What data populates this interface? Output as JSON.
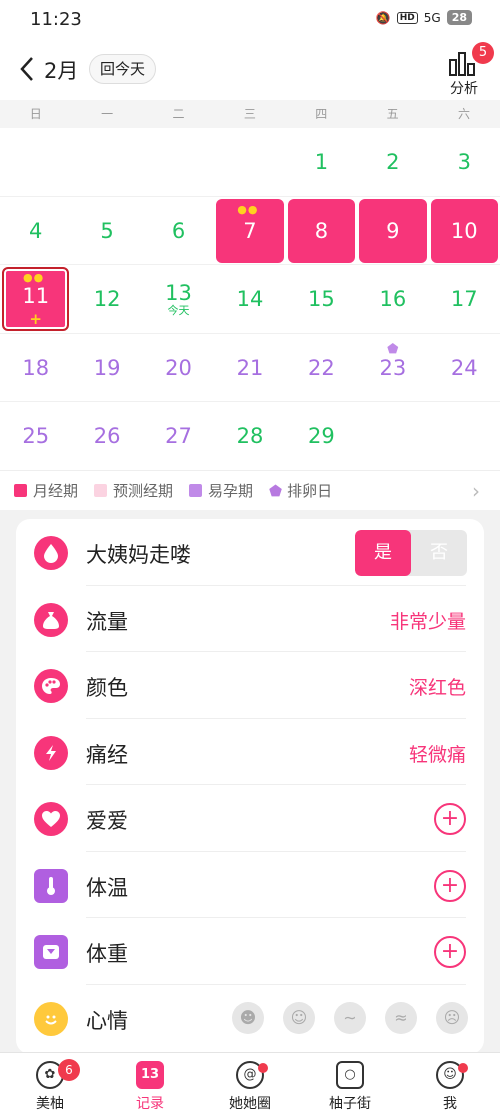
{
  "status": {
    "time": "11:23",
    "hd": "HD",
    "network": "5G",
    "battery": "28"
  },
  "header": {
    "back_icon": "chevron-left-icon",
    "month": "2月",
    "today_button": "回今天",
    "analysis_label": "分析",
    "analysis_badge": "5"
  },
  "weekdays": [
    "日",
    "一",
    "二",
    "三",
    "四",
    "五",
    "六"
  ],
  "calendar": {
    "rows": [
      [
        null,
        null,
        null,
        null,
        {
          "n": "1",
          "t": "normal"
        },
        {
          "n": "2",
          "t": "normal"
        },
        {
          "n": "3",
          "t": "normal"
        }
      ],
      [
        {
          "n": "4",
          "t": "normal"
        },
        {
          "n": "5",
          "t": "normal"
        },
        {
          "n": "6",
          "t": "normal"
        },
        {
          "n": "7",
          "t": "period",
          "mark_top": true
        },
        {
          "n": "8",
          "t": "period"
        },
        {
          "n": "9",
          "t": "period"
        },
        {
          "n": "10",
          "t": "period"
        }
      ],
      [
        {
          "n": "11",
          "t": "period",
          "selected": true,
          "mark_top": true,
          "mark_bottom": true
        },
        {
          "n": "12",
          "t": "normal"
        },
        {
          "n": "13",
          "t": "normal",
          "sub": "今天"
        },
        {
          "n": "14",
          "t": "normal"
        },
        {
          "n": "15",
          "t": "normal"
        },
        {
          "n": "16",
          "t": "normal"
        },
        {
          "n": "17",
          "t": "normal"
        }
      ],
      [
        {
          "n": "18",
          "t": "fertile"
        },
        {
          "n": "19",
          "t": "fertile"
        },
        {
          "n": "20",
          "t": "fertile"
        },
        {
          "n": "21",
          "t": "fertile"
        },
        {
          "n": "22",
          "t": "fertile"
        },
        {
          "n": "23",
          "t": "fertile",
          "flower": true
        },
        {
          "n": "24",
          "t": "fertile"
        }
      ],
      [
        {
          "n": "25",
          "t": "fertile"
        },
        {
          "n": "26",
          "t": "fertile"
        },
        {
          "n": "27",
          "t": "fertile"
        },
        {
          "n": "28",
          "t": "normal"
        },
        {
          "n": "29",
          "t": "normal"
        },
        null,
        null
      ]
    ]
  },
  "legend": {
    "period": "月经期",
    "predicted": "预测经期",
    "fertile": "易孕期",
    "ovulation": "排卵日",
    "colors": {
      "period": "#f7357a",
      "predicted": "#fbd3e1",
      "fertile": "#c08ae8",
      "ovulation": "#b779e0"
    }
  },
  "records": {
    "period_end": {
      "label": "大姨妈走喽",
      "yes": "是",
      "no": "否"
    },
    "flow": {
      "label": "流量",
      "value": "非常少量"
    },
    "color": {
      "label": "颜色",
      "value": "深红色"
    },
    "pain": {
      "label": "痛经",
      "value": "轻微痛"
    },
    "love": {
      "label": "爱爱"
    },
    "temperature": {
      "label": "体温"
    },
    "weight": {
      "label": "体重"
    },
    "mood": {
      "label": "心情"
    }
  },
  "tabs": [
    {
      "label": "美柚",
      "badge": "6",
      "icon": "meiyou-icon"
    },
    {
      "label": "记录",
      "icon_text": "13",
      "active": true,
      "icon": "calendar-icon"
    },
    {
      "label": "她她圈",
      "dot": true,
      "icon": "circle-icon"
    },
    {
      "label": "柚子街",
      "icon": "shopping-bag-icon"
    },
    {
      "label": "我",
      "dot": true,
      "icon": "profile-icon"
    }
  ]
}
